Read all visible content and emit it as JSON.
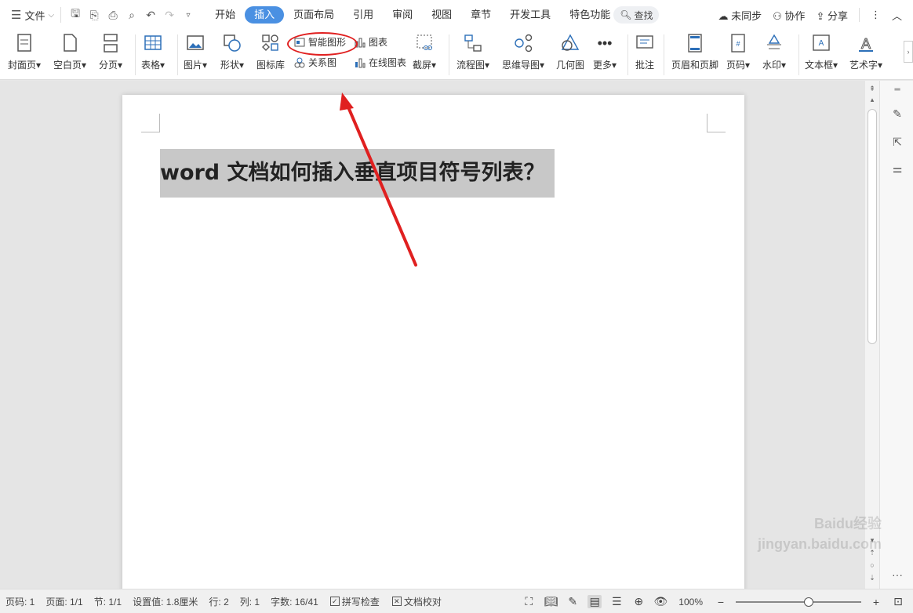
{
  "menubar": {
    "file_label": "文件",
    "tabs": [
      {
        "label": "开始",
        "active": false
      },
      {
        "label": "插入",
        "active": true
      },
      {
        "label": "页面布局",
        "active": false
      },
      {
        "label": "引用",
        "active": false
      },
      {
        "label": "审阅",
        "active": false
      },
      {
        "label": "视图",
        "active": false
      },
      {
        "label": "章节",
        "active": false
      },
      {
        "label": "开发工具",
        "active": false
      },
      {
        "label": "特色功能",
        "active": false
      }
    ],
    "find_label": "查找",
    "sync_label": "未同步",
    "collab_label": "协作",
    "share_label": "分享"
  },
  "ribbon": {
    "cover_page": "封面页",
    "blank_page": "空白页",
    "page_break": "分页",
    "table": "表格",
    "picture": "图片",
    "shape": "形状",
    "icon_library": "图标库",
    "smart_art": "智能图形",
    "relation_chart": "关系图",
    "chart": "图表",
    "online_chart": "在线图表",
    "screenshot": "截屏",
    "flowchart": "流程图",
    "mindmap": "思维导图",
    "geometry": "几何图",
    "more": "更多",
    "comment": "批注",
    "header_footer": "页眉和页脚",
    "page_number": "页码",
    "watermark": "水印",
    "text_box": "文本框",
    "word_art": "艺术字"
  },
  "document": {
    "title": "word 文档如何插入垂直项目符号列表？"
  },
  "status": {
    "page_num": "页码: 1",
    "pages": "页面: 1/1",
    "section": "节: 1/1",
    "setting": "设置值: 1.8厘米",
    "row": "行: 2",
    "col": "列: 1",
    "word_count": "字数: 16/41",
    "spell_check": "拼写检查",
    "doc_proof": "文档校对",
    "zoom": "100%",
    "zoom_fraction": 0.58
  },
  "watermark_text": "Baidu经验 jingyan.baidu.com",
  "colors": {
    "accent": "#4a90e2",
    "annotation_red": "#e02020"
  }
}
